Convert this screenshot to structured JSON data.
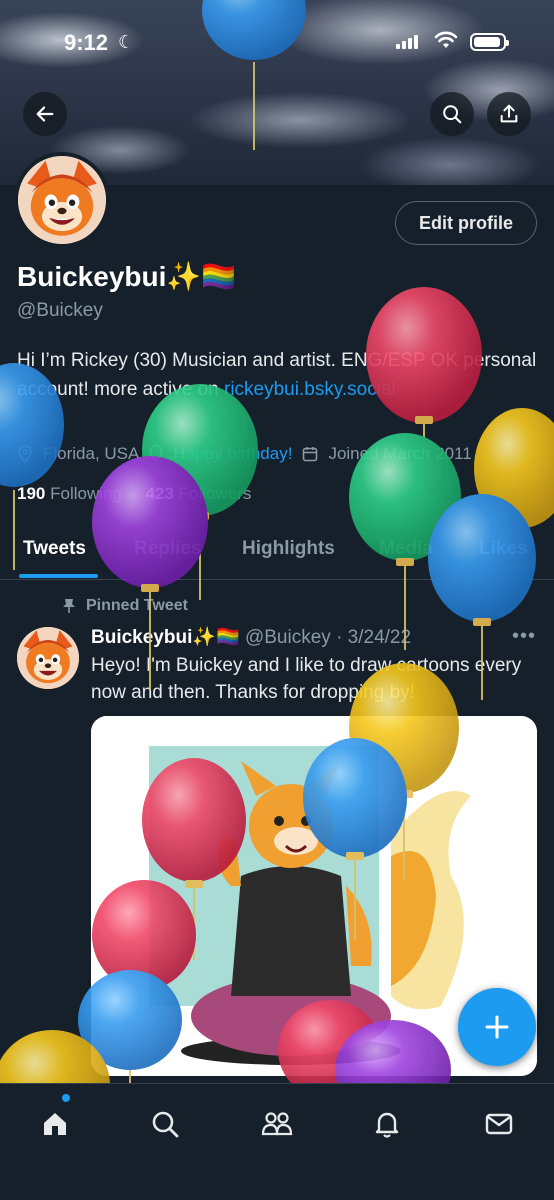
{
  "status": {
    "time": "9:12"
  },
  "profile": {
    "name": "Buickeybui✨🏳️‍🌈",
    "handle": "@Buickey",
    "edit_label": "Edit profile",
    "bio_text": "Hi I’m Rickey (30) Musician and artist. ENG/ESP OK personal account! more active on ",
    "bio_link": "rickeybui.bsky.social",
    "location": "Florida, USA",
    "birthday": "Happy birthday!",
    "joined": "Joined March 2011",
    "following_count": "190",
    "following_label": "Following",
    "followers_count": "423",
    "followers_label": "Followers"
  },
  "tabs": [
    {
      "label": "Tweets"
    },
    {
      "label": "Replies"
    },
    {
      "label": "Highlights"
    },
    {
      "label": "Media"
    },
    {
      "label": "Likes"
    }
  ],
  "tweet": {
    "pinned_label": "Pinned Tweet",
    "author": "Buickeybui✨🏳️‍🌈",
    "handle_date": "@Buickey · 3/24/22",
    "text": "Heyo! I'm Buickey and I like to draw cartoons every now and then. Thanks for dropping by!"
  },
  "colors": {
    "accent": "#1d9bf0",
    "background": "#15202b",
    "muted": "#8b98a5"
  },
  "icons": [
    "back-arrow-icon",
    "search-icon",
    "share-icon",
    "location-icon",
    "balloon-icon",
    "calendar-icon",
    "pin-icon",
    "more-icon",
    "compose-plus-icon",
    "home-icon",
    "explore-icon",
    "communities-icon",
    "notifications-icon",
    "messages-icon"
  ]
}
